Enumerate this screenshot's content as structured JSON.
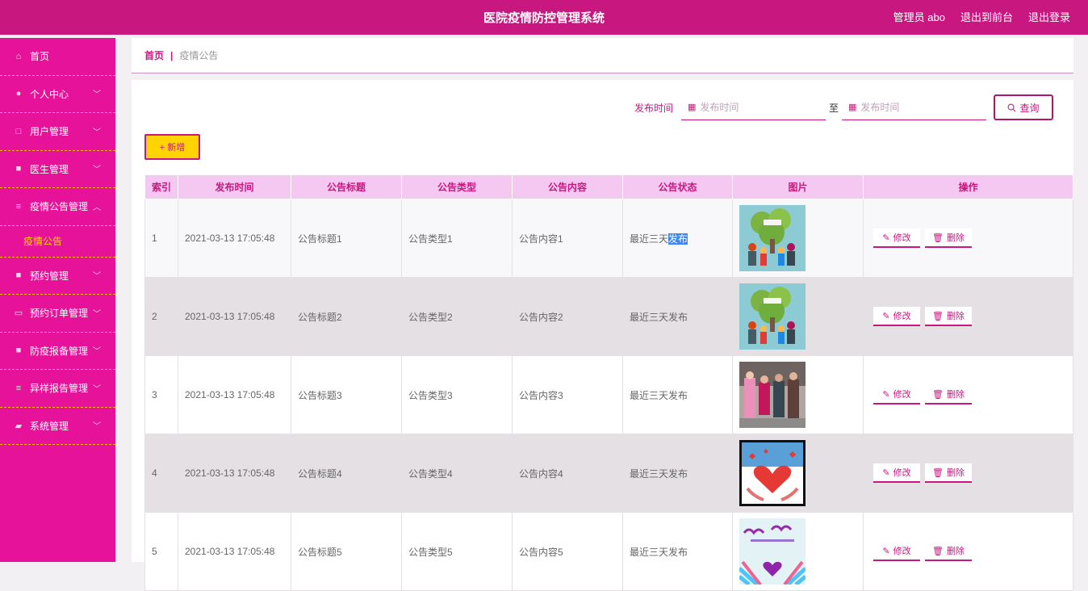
{
  "header": {
    "title": "医院疫情防控管理系统",
    "user": "管理员 abo",
    "front_link": "退出到前台",
    "logout_link": "退出登录"
  },
  "sidebar": {
    "items": [
      {
        "label": "首页",
        "icon": "home-icon",
        "glyph": "⌂",
        "chevron": ""
      },
      {
        "label": "个人中心",
        "icon": "user-icon",
        "glyph": "●",
        "chevron": "﹀"
      },
      {
        "label": "用户管理",
        "icon": "window-icon",
        "glyph": "□",
        "chevron": "﹀"
      },
      {
        "label": "医生管理",
        "icon": "check-icon",
        "glyph": "■",
        "chevron": "﹀"
      },
      {
        "label": "疫情公告管理",
        "icon": "list-icon",
        "glyph": "≡",
        "chevron": "︿"
      },
      {
        "label": "疫情公告",
        "icon": "",
        "glyph": "",
        "chevron": "",
        "sub": true
      },
      {
        "label": "预约管理",
        "icon": "clipboard-icon",
        "glyph": "■",
        "chevron": "﹀"
      },
      {
        "label": "预约订单管理",
        "icon": "message-icon",
        "glyph": "▭",
        "chevron": "﹀"
      },
      {
        "label": "防疫报备管理",
        "icon": "doc-icon",
        "glyph": "■",
        "chevron": "﹀"
      },
      {
        "label": "异样报告管理",
        "icon": "list-icon",
        "glyph": "≡",
        "chevron": "﹀"
      },
      {
        "label": "系统管理",
        "icon": "tool-icon",
        "glyph": "▰",
        "chevron": "﹀"
      }
    ]
  },
  "breadcrumb": {
    "home": "首页",
    "sep": "|",
    "current": "疫情公告"
  },
  "search": {
    "label": "发布时间",
    "start_placeholder": "发布时间",
    "to": "至",
    "end_placeholder": "发布时间",
    "query_label": "查询",
    "calendar_glyph": "▦"
  },
  "add_button": "+ 新增",
  "table": {
    "headers": [
      "索引",
      "发布时间",
      "公告标题",
      "公告类型",
      "公告内容",
      "公告状态",
      "图片",
      "操作"
    ],
    "edit_label": "修改",
    "delete_label": "删除",
    "rows": [
      {
        "idx": "1",
        "time": "2021-03-13 17:05:48",
        "title": "公告标题1",
        "type": "公告类型1",
        "content": "公告内容1",
        "status_a": "最近三天",
        "status_b": "发布",
        "image": "tree-illustration"
      },
      {
        "idx": "2",
        "time": "2021-03-13 17:05:48",
        "title": "公告标题2",
        "type": "公告类型2",
        "content": "公告内容2",
        "status_a": "最近三天发布",
        "status_b": "",
        "image": "tree-illustration"
      },
      {
        "idx": "3",
        "time": "2021-03-13 17:05:48",
        "title": "公告标题3",
        "type": "公告类型3",
        "content": "公告内容3",
        "status_a": "最近三天发布",
        "status_b": "",
        "image": "crowd-photo"
      },
      {
        "idx": "4",
        "time": "2021-03-13 17:05:48",
        "title": "公告标题4",
        "type": "公告类型4",
        "content": "公告内容4",
        "status_a": "最近三天发布",
        "status_b": "",
        "image": "heart-hands"
      },
      {
        "idx": "5",
        "time": "2021-03-13 17:05:48",
        "title": "公告标题5",
        "type": "公告类型5",
        "content": "公告内容5",
        "status_a": "最近三天发布",
        "status_b": "",
        "image": "charity-poster"
      }
    ]
  }
}
